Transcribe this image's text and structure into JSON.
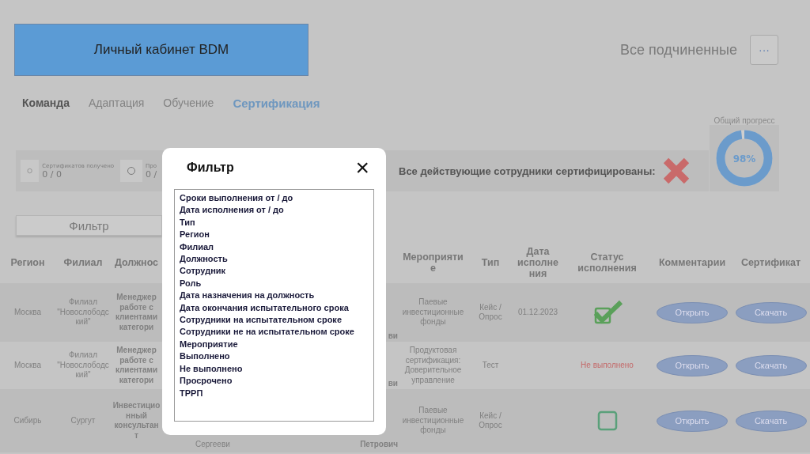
{
  "header": {
    "title": "Личный кабинет BDM",
    "scope": "Все подчиненные",
    "menu_button": "···"
  },
  "tabs": [
    {
      "label": "Команда",
      "selected": false
    },
    {
      "label": "Адаптация",
      "selected": false
    },
    {
      "label": "Обучение",
      "selected": false
    },
    {
      "label": "Сертификация",
      "selected": true
    }
  ],
  "stats": [
    {
      "label": "Сертификатов получено",
      "value": "0 / 0"
    },
    {
      "label": "Про",
      "value": "0 /"
    }
  ],
  "certified": {
    "label": "Все действующие сотрудники сертифицированы:",
    "ok": false
  },
  "progress": {
    "title": "Общий прогресс",
    "level": 0.98,
    "reading": "98%"
  },
  "filter_button": "Фильтр",
  "table": {
    "columns": [
      "Регион",
      "Филиал",
      "Должнос",
      "",
      "Мероприятие",
      "Тип",
      "Дата исполнения",
      "Статус исполнения",
      "Комментарии",
      "Сертификат"
    ],
    "rows": [
      {
        "region": "Москва",
        "branch": "Филиал \"Новослободский\"",
        "position": "Менеджер работе с клиентами категори",
        "hidden_left": "",
        "hidden_right": "ви",
        "event": "Паевые инвестиционные фонды",
        "type": "Кейс / Опрос",
        "date": "01.12.2023",
        "status": {
          "kind": "checkbox",
          "checked": true
        },
        "comment": "Открыть",
        "certificate": "Скачать"
      },
      {
        "region": "Москва",
        "branch": "Филиал \"Новослободский\"",
        "position": "Менеджер работе с клиентами категори",
        "hidden_left": "",
        "hidden_right": "ви",
        "event": "Продуктовая сертификация: Доверительное управление",
        "type": "Тест",
        "date": "",
        "status": {
          "kind": "text",
          "text": "Не выполнено"
        },
        "comment": "Открыть",
        "certificate": "Скачать"
      },
      {
        "region": "Сибирь",
        "branch": "Сургут",
        "position": "Инвестиционный консультант",
        "hidden_left": "Сергееви",
        "hidden_right": "Петрович",
        "event": "Паевые инвестиционные фонды",
        "type": "Кейс / Опрос",
        "date": "",
        "status": {
          "kind": "checkbox",
          "checked": false
        },
        "comment": "Открыть",
        "certificate": "Скачать"
      }
    ]
  },
  "modal": {
    "title": "Фильтр",
    "close": "×",
    "options": [
      "Сроки выполнения от / до",
      "Дата исполнения от / до",
      "Тип",
      "Регион",
      "Филиал",
      "Должность",
      "Сотрудник",
      "Роль",
      "Дата назначения на должность",
      "Дата окончания испытательного срока",
      "Сотрудники на испытательном сроке",
      "Сотрудники не на испытательном сроке",
      "Мероприятие",
      "Выполнено",
      "Не выполнено",
      "Просрочено",
      "ТРРП"
    ]
  }
}
